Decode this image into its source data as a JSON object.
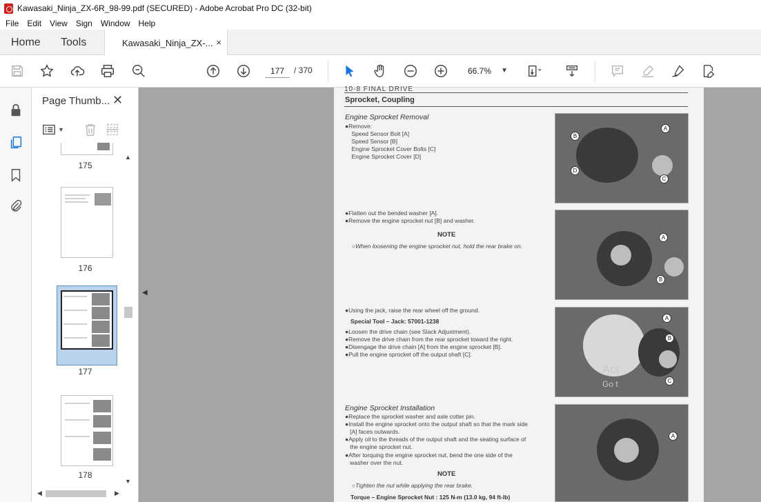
{
  "window": {
    "title": "Kawasaki_Ninja_ZX-6R_98-99.pdf (SECURED) - Adobe Acrobat Pro DC (32-bit)"
  },
  "menu": [
    "File",
    "Edit",
    "View",
    "Sign",
    "Window",
    "Help"
  ],
  "tabs": {
    "home": "Home",
    "tools": "Tools",
    "document": "Kawasaki_Ninja_ZX-...",
    "close": "×"
  },
  "toolbar": {
    "current_page": "177",
    "page_total": "/ 370",
    "zoom": "66.7%"
  },
  "thumbnail_panel": {
    "title": "Page Thumb...",
    "close": "✕",
    "thumbs": [
      {
        "label": "175"
      },
      {
        "label": "176"
      },
      {
        "label": "177",
        "selected": true
      },
      {
        "label": "178"
      }
    ]
  },
  "page": {
    "header": "10-8 FINAL DRIVE",
    "section": "Sprocket, Coupling",
    "removal": {
      "heading": "Engine Sprocket Removal",
      "lines": [
        "●Remove:",
        "    Speed Sensor Bolt [A]",
        "    Speed Sensor [B]",
        "    Engine Sprocket Cover Bolts [C]",
        "    Engine Sprocket Cover [D]"
      ]
    },
    "flatten": {
      "lines": [
        "●Flatten out the bended washer [A].",
        "●Remove the engine sprocket nut [B] and washer."
      ],
      "note_title": "NOTE",
      "note": "○When loosening the engine sprocket nut, hold the rear brake on."
    },
    "jack": {
      "line1": "●Using the jack, raise the rear wheel off the ground.",
      "special_tool": "Special Tool  –  Jack:  57001-1238",
      "lines": [
        "●Loosen the drive chain (see Slack Adjustment).",
        "●Remove the drive chain from the rear sprocket toward the right.",
        "●Disengage the drive chain [A] from the engine sprocket [B].",
        "●Pull the engine sprocket off the output shaft [C]."
      ]
    },
    "installation": {
      "heading": "Engine Sprocket Installation",
      "lines": [
        "●Replace the sprocket washer and axle cotter pin.",
        "●Install the engine sprocket onto the output shaft so that the mark side",
        "   [A] faces outwards.",
        "●Apply oil to the threads of the output shaft and the seating surface of",
        "   the engine sprocket nut.",
        "●After torquing the engine sprocket nut, bend the one side of the",
        "   washer over the nut."
      ],
      "note_title": "NOTE",
      "note": "○Tighten the nut while applying the rear brake.",
      "torque": "Torque  –  Engine Sprocket Nut : 125 N-m (13.0 kg, 94 ft-lb)"
    },
    "callouts": {
      "photo1": [
        "A",
        "B",
        "C",
        "D"
      ],
      "photo2": [
        "A",
        "B"
      ],
      "photo3": [
        "A",
        "B",
        "C"
      ],
      "photo4": [
        "A"
      ]
    }
  },
  "watermark": {
    "line1": "Act",
    "line2": "Go t"
  }
}
